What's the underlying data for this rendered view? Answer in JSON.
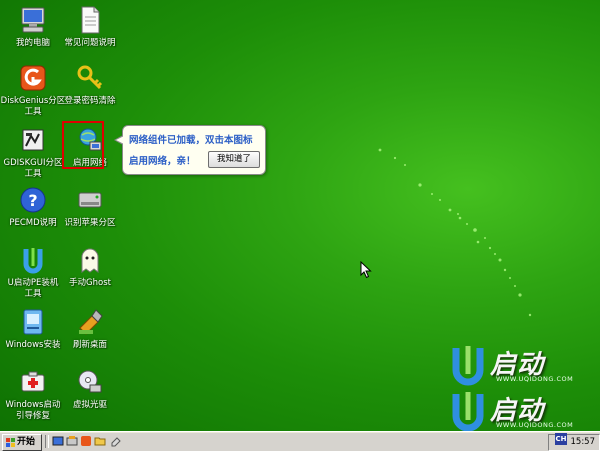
{
  "desktop": {
    "icons": [
      {
        "label": "我的电脑",
        "icon": "computer-icon"
      },
      {
        "label": "常见问题说明",
        "icon": "document-icon"
      },
      {
        "label": "DiskGenius分区\n工具",
        "icon": "diskgenius-icon"
      },
      {
        "label": "登录密码清除",
        "icon": "key-icon"
      },
      {
        "label": "GDISKGUI分区\n工具",
        "icon": "gdisk-icon"
      },
      {
        "label": "启用网络",
        "icon": "network-icon"
      },
      {
        "label": "PECMD说明",
        "icon": "help-icon"
      },
      {
        "label": "识别苹果分区",
        "icon": "drive-icon"
      },
      {
        "label": "U启动PE装机\n工具",
        "icon": "u-installer-icon"
      },
      {
        "label": "手动Ghost",
        "icon": "ghost-icon"
      },
      {
        "label": "Windows安装",
        "icon": "windows-install-icon"
      },
      {
        "label": "刷新桌面",
        "icon": "refresh-desktop-icon"
      },
      {
        "label": "Windows启动\n引导修复",
        "icon": "boot-repair-icon"
      },
      {
        "label": "虚拟光驱",
        "icon": "virtual-drive-icon"
      }
    ]
  },
  "balloon": {
    "line1": "网络组件已加载，双击本图标",
    "line2": "启用网络，亲！",
    "button": "我知道了"
  },
  "wallpaper": {
    "logo_text": "启动",
    "logo_url": "WWW.UQIDONG.COM",
    "logo_text2": "启动",
    "logo_url2": "WWW.UQIDONG.COM"
  },
  "taskbar": {
    "start_label": "开始",
    "language": "CH",
    "clock": "15:57"
  },
  "colors": {
    "selection": "#e00000",
    "balloon_text": "#2b5ec6",
    "desktop": "#1d8e08"
  }
}
